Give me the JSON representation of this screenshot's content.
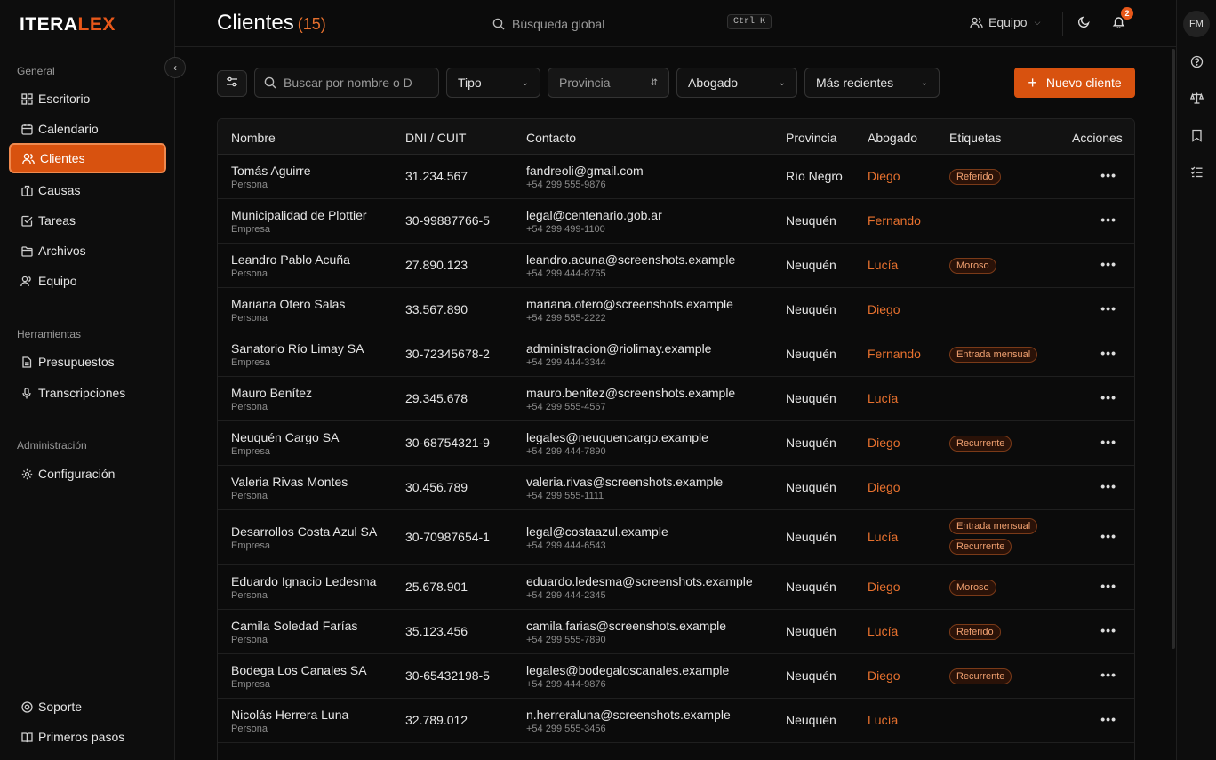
{
  "brand": {
    "part1": "ITERA",
    "part2": "LEX",
    "accent": "#e8581a"
  },
  "sidebar": {
    "sections": [
      {
        "title": "General"
      },
      {
        "title": "Herramientas"
      },
      {
        "title": "Administración"
      }
    ],
    "items": [
      {
        "label": "Escritorio",
        "icon": "grid-icon"
      },
      {
        "label": "Calendario",
        "icon": "calendar-icon"
      },
      {
        "label": "Clientes",
        "icon": "users-icon",
        "active": true
      },
      {
        "label": "Causas",
        "icon": "briefcase-icon"
      },
      {
        "label": "Tareas",
        "icon": "checkbox-icon"
      },
      {
        "label": "Archivos",
        "icon": "folder-icon"
      },
      {
        "label": "Equipo",
        "icon": "team-icon"
      },
      {
        "label": "Presupuestos",
        "icon": "document-icon"
      },
      {
        "label": "Transcripciones",
        "icon": "microphone-icon"
      },
      {
        "label": "Configuración",
        "icon": "gear-icon"
      },
      {
        "label": "Soporte",
        "icon": "lifebuoy-icon"
      },
      {
        "label": "Primeros pasos",
        "icon": "book-icon"
      }
    ]
  },
  "header": {
    "title": "Clientes",
    "count": "(15)",
    "search_placeholder": "Búsqueda global",
    "shortcut": "Ctrl K",
    "team_label": "Equipo",
    "notifications": "2",
    "avatar": "FM"
  },
  "filters": {
    "search_placeholder": "Buscar por nombre o D",
    "type": "Tipo",
    "province": "Provincia",
    "lawyer": "Abogado",
    "sort": "Más recientes",
    "new_button": "Nuevo cliente"
  },
  "table": {
    "columns": [
      "Nombre",
      "DNI / CUIT",
      "Contacto",
      "Provincia",
      "Abogado",
      "Etiquetas",
      "Acciones"
    ],
    "rows": [
      {
        "name": "Tomás Aguirre",
        "type": "Persona",
        "id": "31.234.567",
        "email": "fandreoli@gmail.com",
        "phone": "+54 299 555-9876",
        "province": "Río Negro",
        "lawyer": "Diego",
        "tags": [
          "Referido"
        ]
      },
      {
        "name": "Municipalidad de Plottier",
        "type": "Empresa",
        "id": "30-99887766-5",
        "email": "legal@centenario.gob.ar",
        "phone": "+54 299 499-1100",
        "province": "Neuquén",
        "lawyer": "Fernando",
        "tags": []
      },
      {
        "name": "Leandro Pablo Acuña",
        "type": "Persona",
        "id": "27.890.123",
        "email": "leandro.acuna@screenshots.example",
        "phone": "+54 299 444-8765",
        "province": "Neuquén",
        "lawyer": "Lucía",
        "tags": [
          "Moroso"
        ]
      },
      {
        "name": "Mariana Otero Salas",
        "type": "Persona",
        "id": "33.567.890",
        "email": "mariana.otero@screenshots.example",
        "phone": "+54 299 555-2222",
        "province": "Neuquén",
        "lawyer": "Diego",
        "tags": []
      },
      {
        "name": "Sanatorio Río Limay SA",
        "type": "Empresa",
        "id": "30-72345678-2",
        "email": "administracion@riolimay.example",
        "phone": "+54 299 444-3344",
        "province": "Neuquén",
        "lawyer": "Fernando",
        "tags": [
          "Entrada mensual"
        ]
      },
      {
        "name": "Mauro Benítez",
        "type": "Persona",
        "id": "29.345.678",
        "email": "mauro.benitez@screenshots.example",
        "phone": "+54 299 555-4567",
        "province": "Neuquén",
        "lawyer": "Lucía",
        "tags": []
      },
      {
        "name": "Neuquén Cargo SA",
        "type": "Empresa",
        "id": "30-68754321-9",
        "email": "legales@neuquencargo.example",
        "phone": "+54 299 444-7890",
        "province": "Neuquén",
        "lawyer": "Diego",
        "tags": [
          "Recurrente"
        ]
      },
      {
        "name": "Valeria Rivas Montes",
        "type": "Persona",
        "id": "30.456.789",
        "email": "valeria.rivas@screenshots.example",
        "phone": "+54 299 555-1111",
        "province": "Neuquén",
        "lawyer": "Diego",
        "tags": []
      },
      {
        "name": "Desarrollos Costa Azul SA",
        "type": "Empresa",
        "id": "30-70987654-1",
        "email": "legal@costaazul.example",
        "phone": "+54 299 444-6543",
        "province": "Neuquén",
        "lawyer": "Lucía",
        "tags": [
          "Entrada mensual",
          "Recurrente"
        ]
      },
      {
        "name": "Eduardo Ignacio Ledesma",
        "type": "Persona",
        "id": "25.678.901",
        "email": "eduardo.ledesma@screenshots.example",
        "phone": "+54 299 444-2345",
        "province": "Neuquén",
        "lawyer": "Diego",
        "tags": [
          "Moroso"
        ]
      },
      {
        "name": "Camila Soledad Farías",
        "type": "Persona",
        "id": "35.123.456",
        "email": "camila.farias@screenshots.example",
        "phone": "+54 299 555-7890",
        "province": "Neuquén",
        "lawyer": "Lucía",
        "tags": [
          "Referido"
        ]
      },
      {
        "name": "Bodega Los Canales SA",
        "type": "Empresa",
        "id": "30-65432198-5",
        "email": "legales@bodegaloscanales.example",
        "phone": "+54 299 444-9876",
        "province": "Neuquén",
        "lawyer": "Diego",
        "tags": [
          "Recurrente"
        ]
      },
      {
        "name": "Nicolás Herrera Luna",
        "type": "Persona",
        "id": "32.789.012",
        "email": "n.herreraluna@screenshots.example",
        "phone": "+54 299 555-3456",
        "province": "Neuquén",
        "lawyer": "Lucía",
        "tags": []
      }
    ],
    "actions_glyph": "•••"
  }
}
